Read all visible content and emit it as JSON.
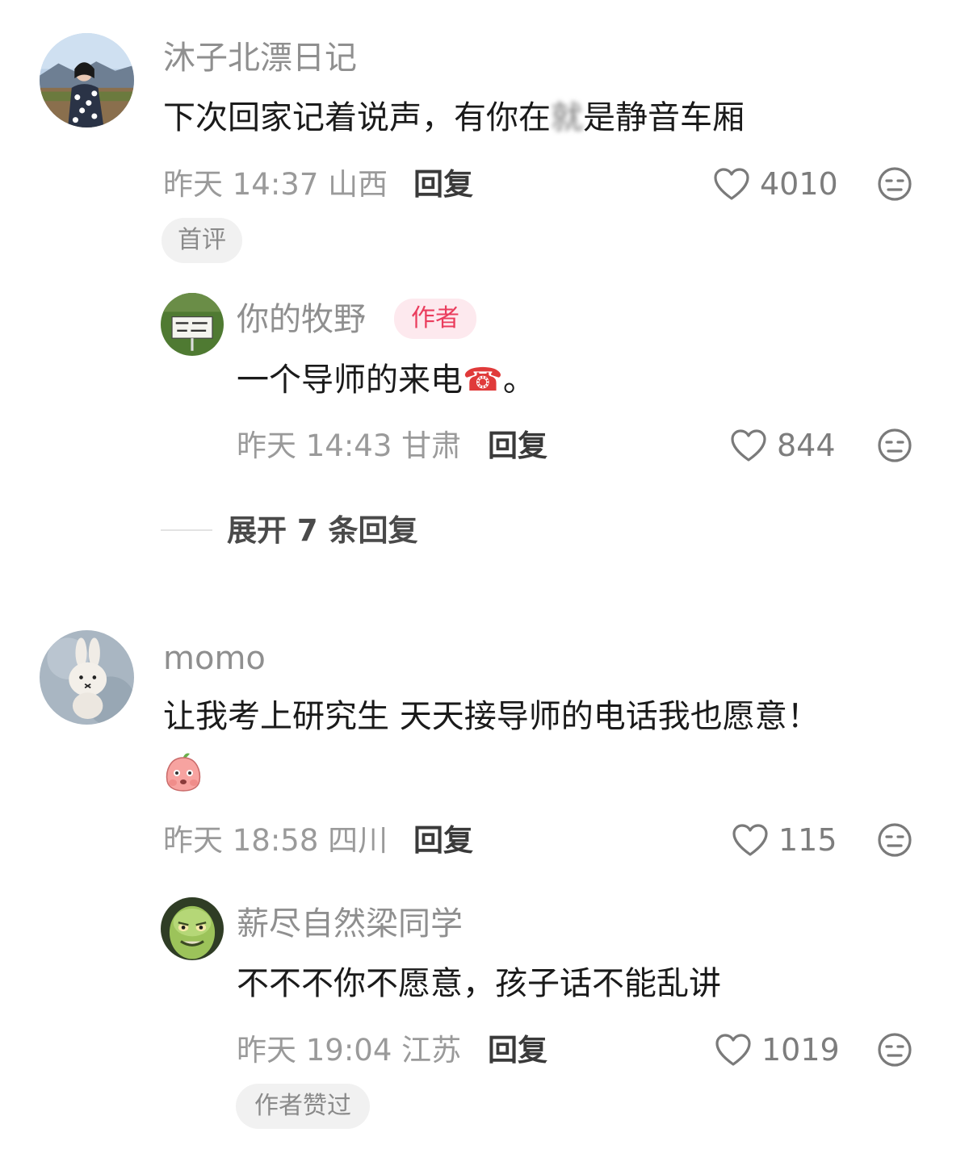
{
  "comments": [
    {
      "user": "沐子北漂日记",
      "text_before": "下次回家记着说声，有你在",
      "text_blur": "就",
      "text_after": "是静音车厢",
      "meta": "昨天 14:37 山西",
      "reply": "回复",
      "likes": "4010",
      "tag": "首评",
      "icons": [
        "heart-icon",
        "neutral-face-icon"
      ]
    },
    {
      "user": "你的牧野",
      "badge": "作者",
      "text": "一个导师的来电",
      "emoji": "☎",
      "text_end": "。",
      "meta": "昨天 14:43 甘肃",
      "reply": "回复",
      "likes": "844"
    },
    {
      "user": "momo",
      "text": "让我考上研究生 天天接导师的电话我也愿意！",
      "meta": "昨天 18:58 四川",
      "reply": "回复",
      "likes": "115"
    },
    {
      "user": "薪尽自然梁同学",
      "text": "不不不你不愿意，孩子话不能乱讲",
      "meta": "昨天 19:04 江苏",
      "reply": "回复",
      "likes": "1019",
      "tag": "作者赞过"
    }
  ],
  "expand": {
    "label": "展开 7 条回复"
  },
  "colors": {
    "author_badge_bg": "#fde9ee",
    "author_badge_text": "#ea3d5d",
    "meta": "#9a9a9a"
  }
}
